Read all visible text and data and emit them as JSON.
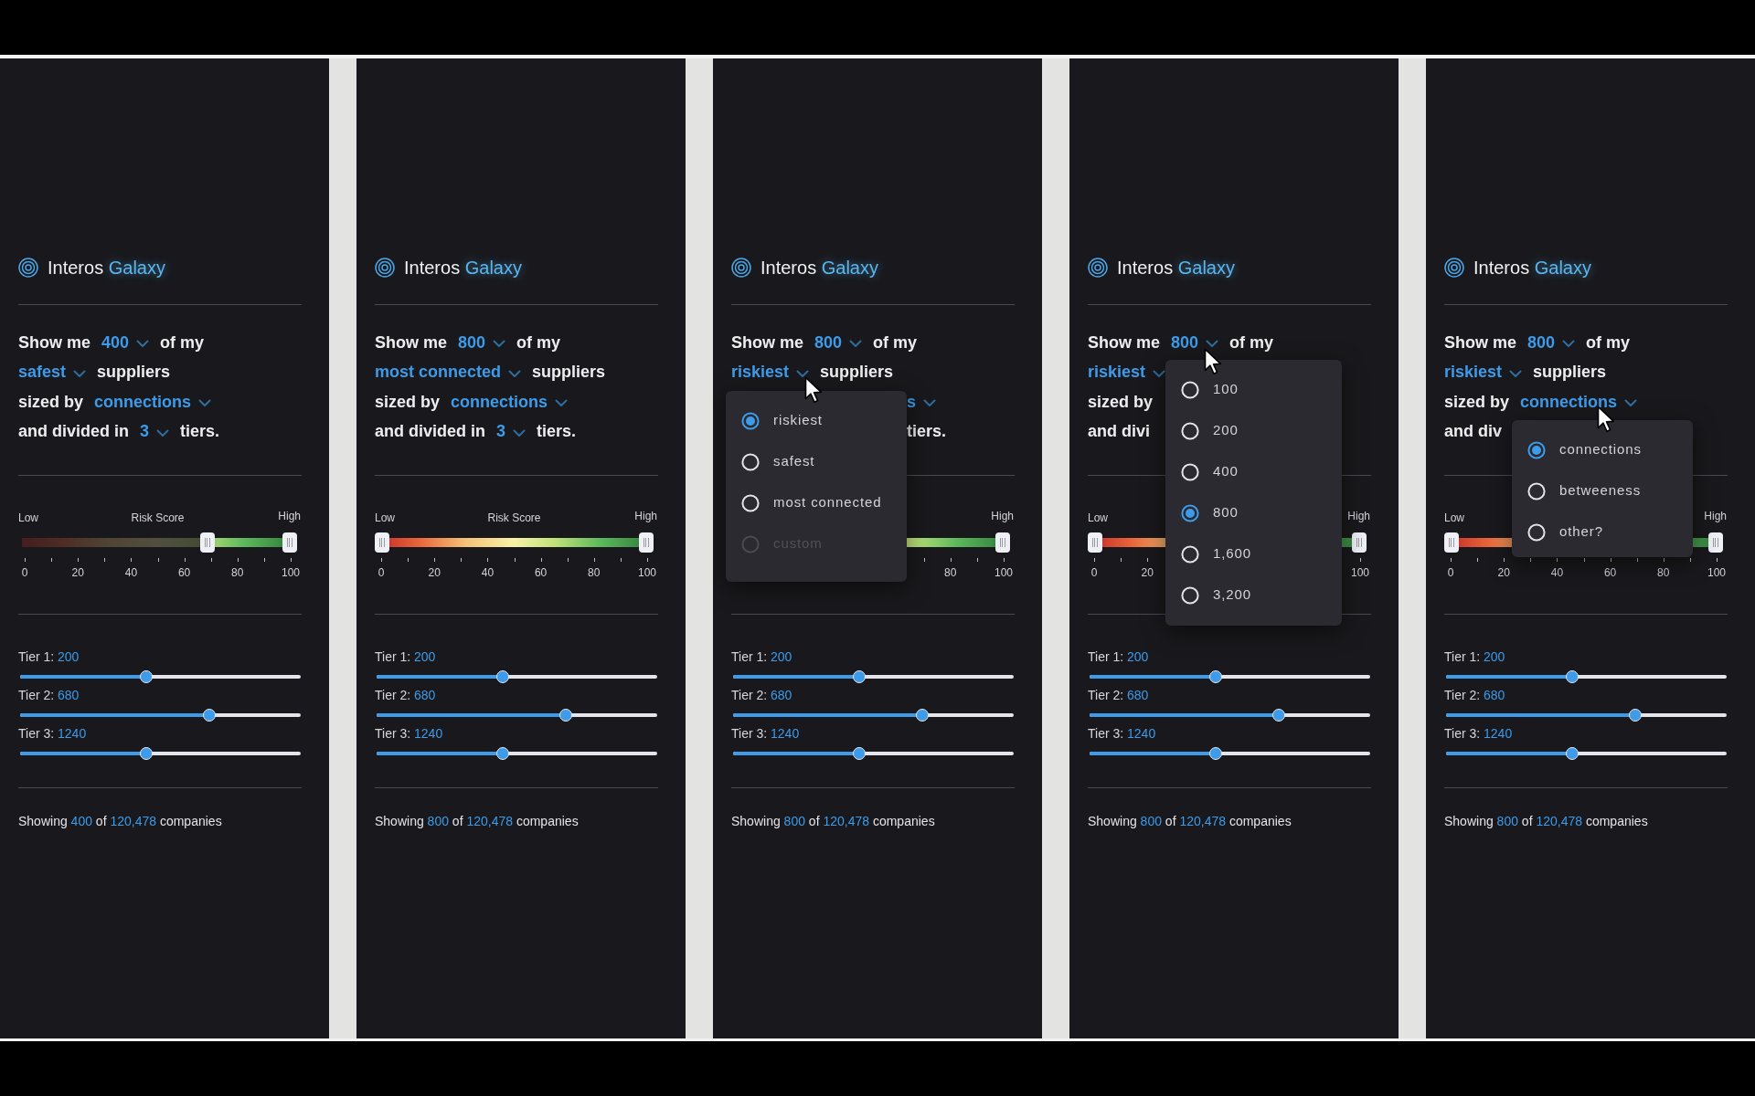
{
  "panels": [
    {
      "title": {
        "brand": "Interos",
        "product": "Galaxy"
      },
      "lines": [
        {
          "segments": [
            {
              "kind": "text",
              "text": "Show me"
            },
            {
              "kind": "select",
              "text": "400"
            },
            {
              "kind": "text",
              "text": "of my"
            }
          ]
        },
        {
          "segments": [
            {
              "kind": "select",
              "text": "safest"
            },
            {
              "kind": "text",
              "text": "suppliers"
            }
          ]
        },
        {
          "segments": [
            {
              "kind": "text",
              "text": "sized by"
            },
            {
              "kind": "select",
              "text": "connections"
            }
          ]
        },
        {
          "segments": [
            {
              "kind": "text",
              "text": "and divided in"
            },
            {
              "kind": "select",
              "text": "3"
            },
            {
              "kind": "text",
              "text": "tiers."
            }
          ]
        }
      ],
      "risk": {
        "labels": {
          "low": "Low",
          "title": "Risk Score",
          "high": "High"
        },
        "low": {
          "level": 0.69
        },
        "high": {
          "level": 1
        },
        "ticks": {
          "0": "0",
          "20": "20",
          "40": "40",
          "60": "60",
          "80": "80",
          "100": "100"
        }
      },
      "tiers": [
        {
          "label": "Tier 1:",
          "value": "200",
          "level": 0.45
        },
        {
          "label": "Tier 2:",
          "value": "680",
          "level": 0.675
        },
        {
          "label": "Tier 3:",
          "value": "1240",
          "level": 0.45
        }
      ],
      "footer": {
        "prefix": "Showing",
        "count": "400",
        "middle": "of",
        "total": "120,478",
        "suffix": "companies"
      }
    },
    {
      "title": {
        "brand": "Interos",
        "product": "Galaxy"
      },
      "lines": [
        {
          "segments": [
            {
              "kind": "text",
              "text": "Show me"
            },
            {
              "kind": "select",
              "text": "800"
            },
            {
              "kind": "text",
              "text": "of my"
            }
          ]
        },
        {
          "segments": [
            {
              "kind": "select",
              "text": "most connected"
            },
            {
              "kind": "text",
              "text": "suppliers"
            }
          ]
        },
        {
          "segments": [
            {
              "kind": "text",
              "text": "sized by"
            },
            {
              "kind": "select",
              "text": "connections"
            }
          ]
        },
        {
          "segments": [
            {
              "kind": "text",
              "text": "and divided in"
            },
            {
              "kind": "select",
              "text": "3"
            },
            {
              "kind": "text",
              "text": "tiers."
            }
          ]
        }
      ],
      "risk": {
        "labels": {
          "low": "Low",
          "title": "Risk Score",
          "high": "High"
        },
        "low": {
          "level": 0
        },
        "high": {
          "level": 1
        },
        "ticks": {
          "0": "0",
          "20": "20",
          "40": "40",
          "60": "60",
          "80": "80",
          "100": "100"
        }
      },
      "tiers": [
        {
          "label": "Tier 1:",
          "value": "200",
          "level": 0.45
        },
        {
          "label": "Tier 2:",
          "value": "680",
          "level": 0.675
        },
        {
          "label": "Tier 3:",
          "value": "1240",
          "level": 0.45
        }
      ],
      "footer": {
        "prefix": "Showing",
        "count": "800",
        "middle": "of",
        "total": "120,478",
        "suffix": "companies"
      }
    },
    {
      "title": {
        "brand": "Interos",
        "product": "Galaxy"
      },
      "lines": [
        {
          "segments": [
            {
              "kind": "text",
              "text": "Show me"
            },
            {
              "kind": "select",
              "text": "800"
            },
            {
              "kind": "text",
              "text": "of my"
            }
          ]
        },
        {
          "segments": [
            {
              "kind": "select",
              "text": "riskiest"
            },
            {
              "kind": "text",
              "text": "suppliers"
            }
          ]
        },
        {
          "after_menu": [
            {
              "kind": "select",
              "text": "s"
            }
          ]
        },
        {
          "after_menu": [
            {
              "kind": "text",
              "text": "tiers."
            }
          ]
        }
      ],
      "risk": {
        "labels": {
          "high": "High"
        },
        "high": {
          "level": 1
        },
        "ticks": {
          "80": "80",
          "100": "100"
        }
      },
      "tiers": [
        {
          "label": "Tier 1:",
          "value": "200",
          "level": 0.45
        },
        {
          "label": "Tier 2:",
          "value": "680",
          "level": 0.675
        },
        {
          "label": "Tier 3:",
          "value": "1240",
          "level": 0.45
        }
      ],
      "footer": {
        "prefix": "Showing",
        "count": "800",
        "middle": "of",
        "total": "120,478",
        "suffix": "companies"
      },
      "menu": {
        "kind": "sort",
        "options": [
          {
            "label": "riskiest",
            "selected": true,
            "disabled": false
          },
          {
            "label": "safest",
            "selected": false,
            "disabled": false
          },
          {
            "label": "most connected",
            "selected": false,
            "disabled": false
          },
          {
            "label": "custom",
            "selected": false,
            "disabled": true
          }
        ]
      }
    },
    {
      "title": {
        "brand": "Interos",
        "product": "Galaxy"
      },
      "lines": [
        {
          "segments": [
            {
              "kind": "text",
              "text": "Show me"
            },
            {
              "kind": "select",
              "text": "800"
            },
            {
              "kind": "text",
              "text": "of my"
            }
          ]
        },
        {
          "segments": [
            {
              "kind": "select",
              "text": "riskiest"
            }
          ]
        },
        {
          "segments": [
            {
              "kind": "text",
              "text": "sized by"
            }
          ]
        },
        {
          "segments": [
            {
              "kind": "text",
              "text": "and divi"
            }
          ]
        }
      ],
      "risk": {
        "labels": {
          "low": "Low",
          "high": "High"
        },
        "low": {
          "level": 0
        },
        "high": {
          "level": 1
        },
        "ticks": {
          "0": "0",
          "20": "20",
          "100": "100"
        }
      },
      "tiers": [
        {
          "label": "Tier 1:",
          "value": "200",
          "level": 0.45
        },
        {
          "label": "Tier 2:",
          "value": "680",
          "level": 0.675
        },
        {
          "label": "Tier 3:",
          "value": "1240",
          "level": 0.45
        }
      ],
      "footer": {
        "prefix": "Showing",
        "count": "800",
        "middle": "of",
        "total": "120,478",
        "suffix": "companies"
      },
      "menu": {
        "kind": "count",
        "options": [
          {
            "label": "100",
            "selected": false
          },
          {
            "label": "200",
            "selected": false
          },
          {
            "label": "400",
            "selected": false
          },
          {
            "label": "800",
            "selected": true
          },
          {
            "label": "1,600",
            "selected": false
          },
          {
            "label": "3,200",
            "selected": false
          }
        ]
      }
    },
    {
      "title": {
        "brand": "Interos",
        "product": "Galaxy"
      },
      "lines": [
        {
          "segments": [
            {
              "kind": "text",
              "text": "Show me"
            },
            {
              "kind": "select",
              "text": "800"
            },
            {
              "kind": "text",
              "text": "of my"
            }
          ]
        },
        {
          "segments": [
            {
              "kind": "select",
              "text": "riskiest"
            },
            {
              "kind": "text",
              "text": "suppliers"
            }
          ]
        },
        {
          "segments": [
            {
              "kind": "text",
              "text": "sized by"
            },
            {
              "kind": "select",
              "text": "connections"
            }
          ]
        },
        {
          "segments": [
            {
              "kind": "text",
              "text": "and div"
            }
          ]
        }
      ],
      "risk": {
        "labels": {
          "low": "Low",
          "high": "High"
        },
        "low": {
          "level": 0
        },
        "high": {
          "level": 1
        },
        "ticks": {
          "0": "0",
          "20": "20",
          "40": "40",
          "60": "60",
          "80": "80",
          "100": "100"
        }
      },
      "tiers": [
        {
          "label": "Tier 1:",
          "value": "200",
          "level": 0.45
        },
        {
          "label": "Tier 2:",
          "value": "680",
          "level": 0.675
        },
        {
          "label": "Tier 3:",
          "value": "1240",
          "level": 0.45
        }
      ],
      "footer": {
        "prefix": "Showing",
        "count": "800",
        "middle": "of",
        "total": "120,478",
        "suffix": "companies"
      },
      "menu": {
        "kind": "size",
        "options": [
          {
            "label": "connections",
            "selected": true
          },
          {
            "label": "betweeness",
            "selected": false
          },
          {
            "label": "other?",
            "selected": false
          }
        ]
      }
    }
  ]
}
